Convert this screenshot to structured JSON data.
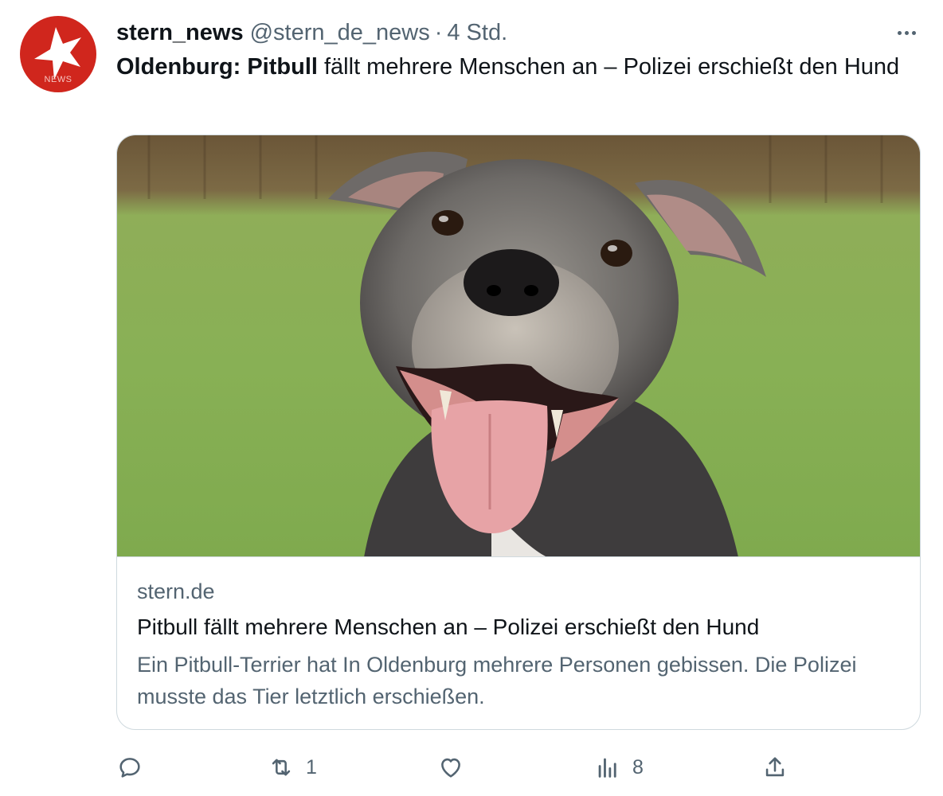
{
  "author": {
    "avatar_label": "NEWS",
    "name": "stern_news",
    "handle": "@stern_de_news",
    "separator": "·",
    "time": "4 Std."
  },
  "tweet": {
    "text_bold_1": "Oldenburg:",
    "text_bold_2": "Pitbull",
    "text_rest": "fällt mehrere Menschen an – Polizei erschießt den Hund"
  },
  "card": {
    "domain": "stern.de",
    "title": "Pitbull fällt mehrere Menschen an – Polizei erschießt den Hund",
    "description": "Ein Pitbull-Terrier hat In Oldenburg mehrere Personen gebissen. Die Polizei musste das Tier letztlich erschießen."
  },
  "actions": {
    "reply_count": "",
    "retweet_count": "1",
    "like_count": "",
    "views_count": "8"
  },
  "icons": {
    "avatar": "stern-star-logo",
    "more": "more-icon",
    "reply": "reply-icon",
    "retweet": "retweet-icon",
    "like": "heart-icon",
    "views": "views-icon",
    "share": "share-icon"
  },
  "colors": {
    "text_primary": "#0f1419",
    "text_secondary": "#536471",
    "border": "#cfd9de",
    "brand_red": "#d0261d"
  }
}
